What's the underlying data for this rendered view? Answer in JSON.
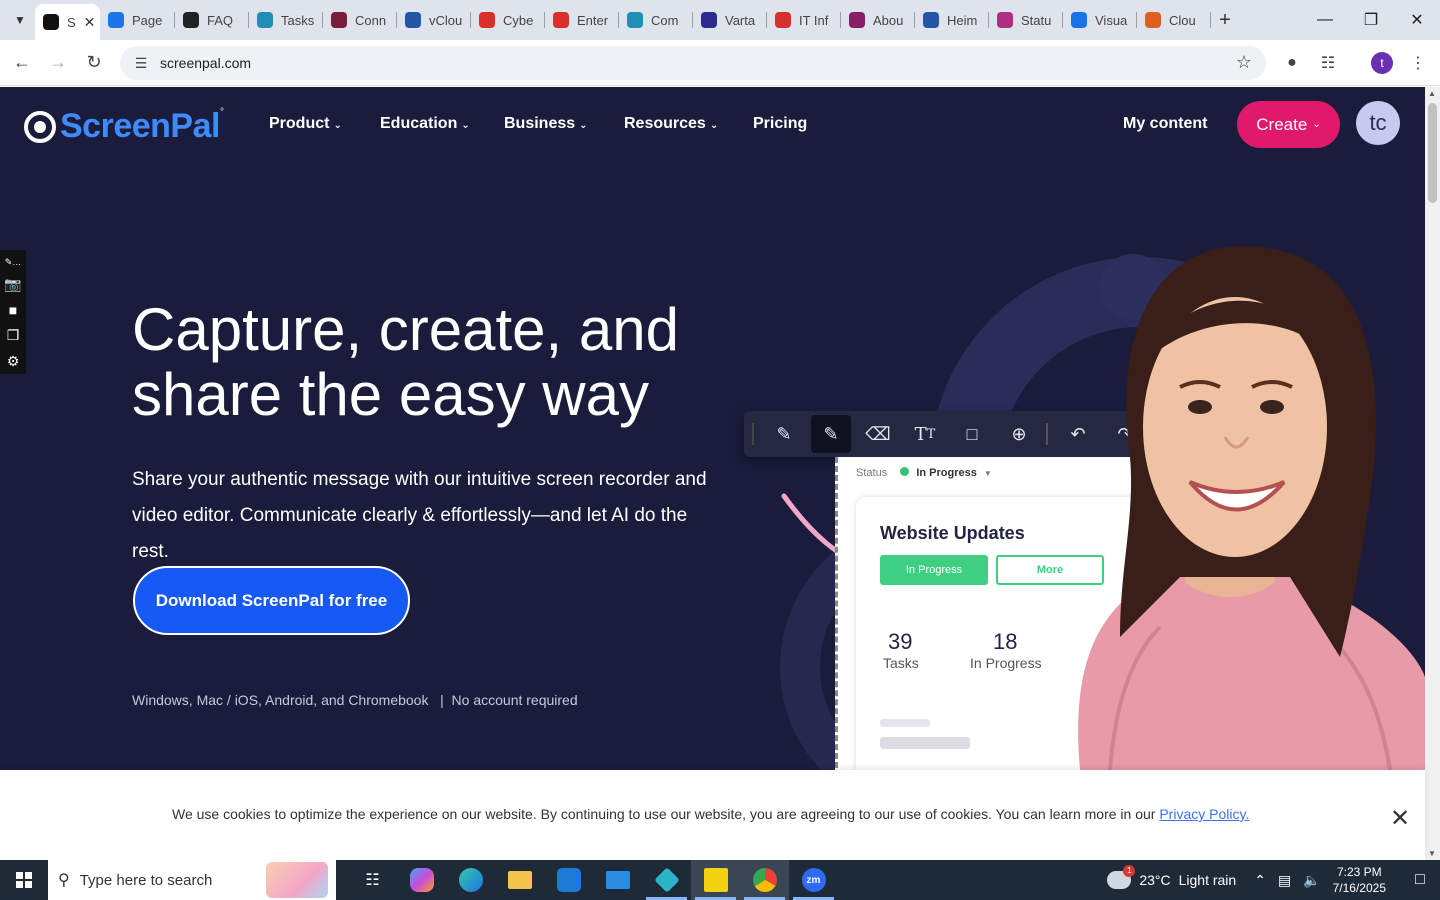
{
  "browser": {
    "tabs": [
      {
        "label": "S",
        "color": "#111111",
        "active": true
      },
      {
        "label": "Page",
        "color": "#1a73e8"
      },
      {
        "label": "FAQ",
        "color": "#222222"
      },
      {
        "label": "Tasks",
        "color": "#1f8fb5"
      },
      {
        "label": "Conn",
        "color": "#7a1c3a"
      },
      {
        "label": "vClou",
        "color": "#2456a6"
      },
      {
        "label": "Cybe",
        "color": "#d9302c"
      },
      {
        "label": "Enter",
        "color": "#d9302c"
      },
      {
        "label": "Com",
        "color": "#1f8fb5"
      },
      {
        "label": "Varta",
        "color": "#2a2a90"
      },
      {
        "label": "IT Inf",
        "color": "#d9302c"
      },
      {
        "label": "Abou",
        "color": "#8a1c6a"
      },
      {
        "label": "Heim",
        "color": "#2456a6"
      },
      {
        "label": "Statu",
        "color": "#b03080"
      },
      {
        "label": "Visua",
        "color": "#1a73e8"
      },
      {
        "label": "Clou",
        "color": "#e06020"
      }
    ],
    "url": "screenpal.com",
    "profile_initial": "t"
  },
  "site": {
    "logo": "ScreenPal",
    "nav": [
      {
        "label": "Product"
      },
      {
        "label": "Education"
      },
      {
        "label": "Business"
      },
      {
        "label": "Resources"
      },
      {
        "label": "Pricing"
      }
    ],
    "my_content": "My content",
    "create": "Create",
    "avatar": "tc"
  },
  "hero": {
    "headline": "Capture, create, and share the easy way",
    "subtext": "Share your authentic message with our intuitive screen recorder and video editor. Communicate clearly & effortlessly—and let AI do the rest.",
    "cta": "Download ScreenPal for free",
    "platforms": "Windows, Mac / iOS, Android, and Chromebook   |  No account required"
  },
  "demo_card": {
    "status_label": "Status",
    "status_value": "In Progress",
    "title": "Website Updates",
    "btn_in_progress": "In Progress",
    "btn_more": "More",
    "tasks_count": "39",
    "tasks_label": "Tasks",
    "progress_count": "18",
    "progress_label": "In Progress"
  },
  "cookie": {
    "message": "We use cookies to optimize the experience on our website. By continuing to use our website, you are agreeing to our use of cookies. You can learn more in our ",
    "link": "Privacy Policy."
  },
  "taskbar": {
    "search_placeholder": "Type here to search",
    "weather_temp": "23°C",
    "weather_desc": "Light rain",
    "weather_badge": "1",
    "time": "7:23 PM",
    "date": "7/16/2025"
  }
}
